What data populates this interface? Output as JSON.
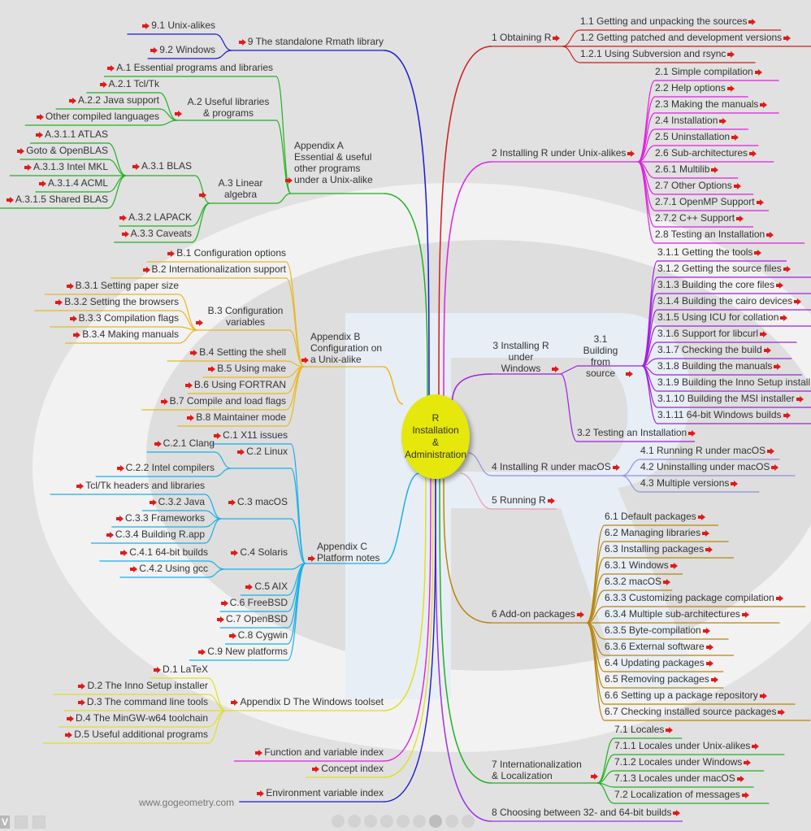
{
  "center": {
    "lines": [
      "R",
      "Installation",
      "&",
      "Administration"
    ],
    "color": "#e5e80a"
  },
  "colors": {
    "arrow": "#e11b1b",
    "ch1": "#d21b1b",
    "ch2": "#dd22dd",
    "ch3": "#a020e0",
    "ch4": "#8f8fe0",
    "ch5": "#e8a0b0",
    "ch6": "#b8860b",
    "ch7": "#22b022",
    "ch8": "#a030e8",
    "ch9": "#1a1ad0",
    "appA": "#22b022",
    "appB": "#e8b820",
    "appC": "#1ab0e8",
    "appD": "#e0e020",
    "idxFn": "#dd22dd",
    "idxConcept": "#e0e020",
    "idxEnv": "#1a1ad0"
  },
  "right": [
    {
      "label": "1 Obtaining R",
      "children": [
        "1.1 Getting and unpacking the sources",
        "1.2 Getting patched and development versions",
        "1.2.1 Using Subversion and rsync"
      ]
    },
    {
      "label": "2 Installing R under Unix-alikes",
      "children": [
        "2.1 Simple compilation",
        "2.2 Help options",
        "2.3 Making the manuals",
        "2.4 Installation",
        "2.5 Uninstallation",
        "2.6 Sub-architectures",
        "2.6.1 Multilib",
        "2.7 Other Options",
        "2.7.1 OpenMP Support",
        "2.7.2 C++ Support",
        "2.8 Testing an Installation"
      ]
    },
    {
      "label": "3 Installing R under Windows",
      "sub": {
        "label": "3.1 Building from source",
        "children": [
          "3.1.1 Getting the tools",
          "3.1.2 Getting the source files",
          "3.1.3 Building the core files",
          "3.1.4 Building the cairo devices",
          "3.1.5 Using ICU for collation",
          "3.1.6 Support for libcurl",
          "3.1.7 Checking the build",
          "3.1.8 Building the manuals",
          "3.1.9 Building the Inno Setup install",
          "3.1.10 Building the MSI installer",
          "3.1.11 64-bit Windows builds"
        ]
      },
      "children": [
        "3.2 Testing an Installation"
      ]
    },
    {
      "label": "4 Installing R under macOS",
      "children": [
        "4.1 Running R under macOS",
        "4.2 Uninstalling under macOS",
        "4.3 Multiple versions"
      ]
    },
    {
      "label": "5 Running R",
      "children": []
    },
    {
      "label": "6 Add-on packages",
      "children": [
        "6.1 Default packages",
        "6.2 Managing libraries",
        "6.3 Installing packages",
        "6.3.1 Windows",
        "6.3.2 macOS",
        "6.3.3 Customizing package compilation",
        "6.3.4 Multiple sub-architectures",
        "6.3.5 Byte-compilation",
        "6.3.6 External software",
        "6.4 Updating packages",
        "6.5 Removing packages",
        "6.6 Setting up a package repository",
        "6.7 Checking installed source packages"
      ]
    },
    {
      "label": "7 Internationalization & Localization",
      "children": [
        "7.1 Locales",
        "7.1.1 Locales under Unix-alikes",
        "7.1.2 Locales under Windows",
        "7.1.3 Locales under macOS",
        "7.2 Localization of messages"
      ]
    },
    {
      "label": "8 Choosing between 32- and 64-bit builds",
      "children": []
    }
  ],
  "left": {
    "ch9": {
      "label": "9 The standalone Rmath library",
      "children": [
        "9.1 Unix-alikes",
        "9.2 Windows"
      ]
    },
    "appA": {
      "label": "Appendix A Essential & useful other programs under a Unix-alike",
      "a1": "A.1 Essential programs and libraries",
      "a2": {
        "label": "A.2 Useful libraries & programs",
        "children": [
          "A.2.1 Tcl/Tk",
          "A.2.2 Java support",
          "Other compiled languages"
        ]
      },
      "a3": {
        "label": "A.3 Linear algebra",
        "a31": {
          "label": "A.3.1 BLAS",
          "children": [
            "A.3.1.1 ATLAS",
            "Goto & OpenBLAS",
            "A.3.1.3 Intel MKL",
            "A.3.1.4 ACML",
            "A.3.1.5 Shared BLAS"
          ]
        },
        "children": [
          "A.3.2 LAPACK",
          "A.3.3 Caveats"
        ]
      }
    },
    "appB": {
      "label": "Appendix B Configuration on a Unix-alike",
      "top": [
        "B.1 Configuration options",
        "B.2 Internationalization support"
      ],
      "b3": {
        "label": "B.3 Configuration variables",
        "children": [
          "B.3.1 Setting paper size",
          "B.3.2 Setting the browsers",
          "B.3.3 Compilation flags",
          "B.3.4 Making manuals"
        ]
      },
      "bottom": [
        "B.4 Setting the shell",
        "B.5 Using make",
        "B.6 Using FORTRAN",
        "B.7 Compile and load flags",
        "B.8 Maintainer mode"
      ]
    },
    "appC": {
      "label": "Appendix C Platform notes",
      "c1": "C.1 X11 issues",
      "c2": {
        "label": "C.2 Linux",
        "children": [
          "C.2.1 Clang",
          "C.2.2 Intel compilers"
        ]
      },
      "c3": {
        "label": "C.3 macOS",
        "children": [
          "Tcl/Tk headers and libraries",
          "C.3.2 Java",
          "C.3.3 Frameworks",
          "C.3.4 Building R.app"
        ]
      },
      "c4": {
        "label": "C.4 Solaris",
        "children": [
          "C.4.1 64-bit builds",
          "C.4.2 Using gcc"
        ]
      },
      "bottom": [
        "C.5 AIX",
        "C.6 FreeBSD",
        "C.7 OpenBSD",
        "C.8 Cygwin",
        "C.9 New platforms"
      ]
    },
    "appD": {
      "label": "Appendix D The Windows toolset",
      "children": [
        "D.1 LaTeX",
        "D.2 The Inno Setup installer",
        "D.3 The command line tools",
        "D.4 The MinGW-w64 toolchain",
        "D.5 Useful additional programs"
      ]
    },
    "indexes": [
      "Function and variable index",
      "Concept index",
      "Environment variable index"
    ]
  },
  "footer": {
    "url": "www.gogeometry.com",
    "toolbar_left_label": "V"
  },
  "icons": {
    "link_arrow": "red-arrow-icon",
    "toolbar_dot_count": 9
  }
}
